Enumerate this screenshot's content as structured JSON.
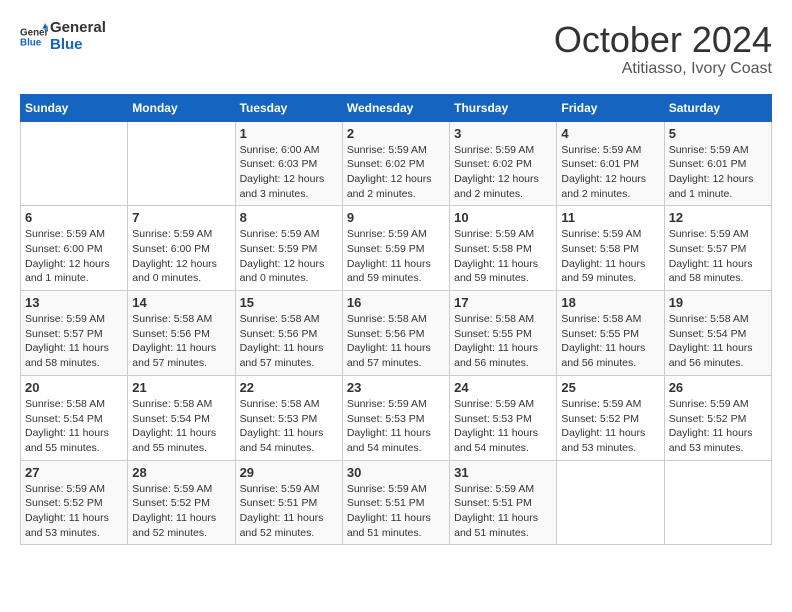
{
  "logo": {
    "line1": "General",
    "line2": "Blue"
  },
  "title": "October 2024",
  "location": "Atitiasso, Ivory Coast",
  "weekdays": [
    "Sunday",
    "Monday",
    "Tuesday",
    "Wednesday",
    "Thursday",
    "Friday",
    "Saturday"
  ],
  "weeks": [
    [
      {
        "day": "",
        "info": ""
      },
      {
        "day": "",
        "info": ""
      },
      {
        "day": "1",
        "info": "Sunrise: 6:00 AM\nSunset: 6:03 PM\nDaylight: 12 hours\nand 3 minutes."
      },
      {
        "day": "2",
        "info": "Sunrise: 5:59 AM\nSunset: 6:02 PM\nDaylight: 12 hours\nand 2 minutes."
      },
      {
        "day": "3",
        "info": "Sunrise: 5:59 AM\nSunset: 6:02 PM\nDaylight: 12 hours\nand 2 minutes."
      },
      {
        "day": "4",
        "info": "Sunrise: 5:59 AM\nSunset: 6:01 PM\nDaylight: 12 hours\nand 2 minutes."
      },
      {
        "day": "5",
        "info": "Sunrise: 5:59 AM\nSunset: 6:01 PM\nDaylight: 12 hours\nand 1 minute."
      }
    ],
    [
      {
        "day": "6",
        "info": "Sunrise: 5:59 AM\nSunset: 6:00 PM\nDaylight: 12 hours\nand 1 minute."
      },
      {
        "day": "7",
        "info": "Sunrise: 5:59 AM\nSunset: 6:00 PM\nDaylight: 12 hours\nand 0 minutes."
      },
      {
        "day": "8",
        "info": "Sunrise: 5:59 AM\nSunset: 5:59 PM\nDaylight: 12 hours\nand 0 minutes."
      },
      {
        "day": "9",
        "info": "Sunrise: 5:59 AM\nSunset: 5:59 PM\nDaylight: 11 hours\nand 59 minutes."
      },
      {
        "day": "10",
        "info": "Sunrise: 5:59 AM\nSunset: 5:58 PM\nDaylight: 11 hours\nand 59 minutes."
      },
      {
        "day": "11",
        "info": "Sunrise: 5:59 AM\nSunset: 5:58 PM\nDaylight: 11 hours\nand 59 minutes."
      },
      {
        "day": "12",
        "info": "Sunrise: 5:59 AM\nSunset: 5:57 PM\nDaylight: 11 hours\nand 58 minutes."
      }
    ],
    [
      {
        "day": "13",
        "info": "Sunrise: 5:59 AM\nSunset: 5:57 PM\nDaylight: 11 hours\nand 58 minutes."
      },
      {
        "day": "14",
        "info": "Sunrise: 5:58 AM\nSunset: 5:56 PM\nDaylight: 11 hours\nand 57 minutes."
      },
      {
        "day": "15",
        "info": "Sunrise: 5:58 AM\nSunset: 5:56 PM\nDaylight: 11 hours\nand 57 minutes."
      },
      {
        "day": "16",
        "info": "Sunrise: 5:58 AM\nSunset: 5:56 PM\nDaylight: 11 hours\nand 57 minutes."
      },
      {
        "day": "17",
        "info": "Sunrise: 5:58 AM\nSunset: 5:55 PM\nDaylight: 11 hours\nand 56 minutes."
      },
      {
        "day": "18",
        "info": "Sunrise: 5:58 AM\nSunset: 5:55 PM\nDaylight: 11 hours\nand 56 minutes."
      },
      {
        "day": "19",
        "info": "Sunrise: 5:58 AM\nSunset: 5:54 PM\nDaylight: 11 hours\nand 56 minutes."
      }
    ],
    [
      {
        "day": "20",
        "info": "Sunrise: 5:58 AM\nSunset: 5:54 PM\nDaylight: 11 hours\nand 55 minutes."
      },
      {
        "day": "21",
        "info": "Sunrise: 5:58 AM\nSunset: 5:54 PM\nDaylight: 11 hours\nand 55 minutes."
      },
      {
        "day": "22",
        "info": "Sunrise: 5:58 AM\nSunset: 5:53 PM\nDaylight: 11 hours\nand 54 minutes."
      },
      {
        "day": "23",
        "info": "Sunrise: 5:59 AM\nSunset: 5:53 PM\nDaylight: 11 hours\nand 54 minutes."
      },
      {
        "day": "24",
        "info": "Sunrise: 5:59 AM\nSunset: 5:53 PM\nDaylight: 11 hours\nand 54 minutes."
      },
      {
        "day": "25",
        "info": "Sunrise: 5:59 AM\nSunset: 5:52 PM\nDaylight: 11 hours\nand 53 minutes."
      },
      {
        "day": "26",
        "info": "Sunrise: 5:59 AM\nSunset: 5:52 PM\nDaylight: 11 hours\nand 53 minutes."
      }
    ],
    [
      {
        "day": "27",
        "info": "Sunrise: 5:59 AM\nSunset: 5:52 PM\nDaylight: 11 hours\nand 53 minutes."
      },
      {
        "day": "28",
        "info": "Sunrise: 5:59 AM\nSunset: 5:52 PM\nDaylight: 11 hours\nand 52 minutes."
      },
      {
        "day": "29",
        "info": "Sunrise: 5:59 AM\nSunset: 5:51 PM\nDaylight: 11 hours\nand 52 minutes."
      },
      {
        "day": "30",
        "info": "Sunrise: 5:59 AM\nSunset: 5:51 PM\nDaylight: 11 hours\nand 51 minutes."
      },
      {
        "day": "31",
        "info": "Sunrise: 5:59 AM\nSunset: 5:51 PM\nDaylight: 11 hours\nand 51 minutes."
      },
      {
        "day": "",
        "info": ""
      },
      {
        "day": "",
        "info": ""
      }
    ]
  ]
}
